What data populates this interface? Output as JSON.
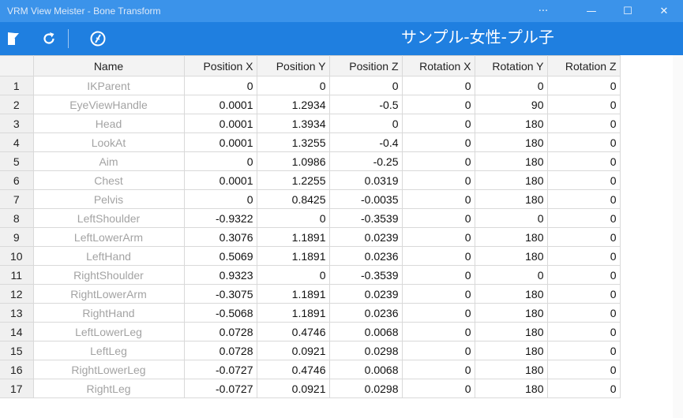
{
  "window": {
    "title": "VRM View Meister - Bone Transform",
    "controls": {
      "more": "···",
      "minimize": "—",
      "maximize": "☐",
      "close": "✕"
    }
  },
  "toolbar": {
    "model_name": "サンプル-女性-プル子",
    "icons": [
      "bookmark-flag-icon",
      "refresh-icon",
      "calibrate-icon"
    ]
  },
  "colors": {
    "titlebar": "#3b93ea",
    "toolbar": "#1f7fe0",
    "name_text": "#a3a3a3"
  },
  "table": {
    "columns": [
      "",
      "Name",
      "Position X",
      "Position Y",
      "Position Z",
      "Rotation X",
      "Rotation Y",
      "Rotation Z"
    ],
    "rows": [
      [
        "1",
        "IKParent",
        "0",
        "0",
        "0",
        "0",
        "0",
        "0"
      ],
      [
        "2",
        "EyeViewHandle",
        "0.0001",
        "1.2934",
        "-0.5",
        "0",
        "90",
        "0"
      ],
      [
        "3",
        "Head",
        "0.0001",
        "1.3934",
        "0",
        "0",
        "180",
        "0"
      ],
      [
        "4",
        "LookAt",
        "0.0001",
        "1.3255",
        "-0.4",
        "0",
        "180",
        "0"
      ],
      [
        "5",
        "Aim",
        "0",
        "1.0986",
        "-0.25",
        "0",
        "180",
        "0"
      ],
      [
        "6",
        "Chest",
        "0.0001",
        "1.2255",
        "0.0319",
        "0",
        "180",
        "0"
      ],
      [
        "7",
        "Pelvis",
        "0",
        "0.8425",
        "-0.0035",
        "0",
        "180",
        "0"
      ],
      [
        "8",
        "LeftShoulder",
        "-0.9322",
        "0",
        "-0.3539",
        "0",
        "0",
        "0"
      ],
      [
        "9",
        "LeftLowerArm",
        "0.3076",
        "1.1891",
        "0.0239",
        "0",
        "180",
        "0"
      ],
      [
        "10",
        "LeftHand",
        "0.5069",
        "1.1891",
        "0.0236",
        "0",
        "180",
        "0"
      ],
      [
        "11",
        "RightShoulder",
        "0.9323",
        "0",
        "-0.3539",
        "0",
        "0",
        "0"
      ],
      [
        "12",
        "RightLowerArm",
        "-0.3075",
        "1.1891",
        "0.0239",
        "0",
        "180",
        "0"
      ],
      [
        "13",
        "RightHand",
        "-0.5068",
        "1.1891",
        "0.0236",
        "0",
        "180",
        "0"
      ],
      [
        "14",
        "LeftLowerLeg",
        "0.0728",
        "0.4746",
        "0.0068",
        "0",
        "180",
        "0"
      ],
      [
        "15",
        "LeftLeg",
        "0.0728",
        "0.0921",
        "0.0298",
        "0",
        "180",
        "0"
      ],
      [
        "16",
        "RightLowerLeg",
        "-0.0727",
        "0.4746",
        "0.0068",
        "0",
        "180",
        "0"
      ],
      [
        "17",
        "RightLeg",
        "-0.0727",
        "0.0921",
        "0.0298",
        "0",
        "180",
        "0"
      ]
    ]
  }
}
